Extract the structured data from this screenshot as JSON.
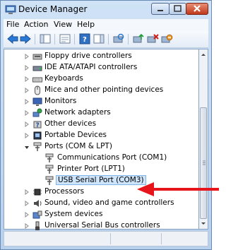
{
  "window": {
    "title": "Device Manager"
  },
  "menu": [
    "File",
    "Action",
    "View",
    "Help"
  ],
  "toolbar": {
    "icons": [
      "back-icon",
      "forward-icon",
      "show-hide-console-tree-icon",
      "properties-icon",
      "help-icon",
      "show-action-pane-icon",
      "scan-hardware-changes-icon",
      "update-driver-icon",
      "uninstall-icon",
      "disable-icon"
    ]
  },
  "tree": {
    "items": [
      {
        "label": "Floppy drive controllers",
        "expanded": false
      },
      {
        "label": "IDE ATA/ATAPI controllers",
        "expanded": false
      },
      {
        "label": "Keyboards",
        "expanded": false
      },
      {
        "label": "Mice and other pointing devices",
        "expanded": false
      },
      {
        "label": "Monitors",
        "expanded": false
      },
      {
        "label": "Network adapters",
        "expanded": false
      },
      {
        "label": "Other devices",
        "expanded": false
      },
      {
        "label": "Portable Devices",
        "expanded": false
      },
      {
        "label": "Ports (COM & LPT)",
        "expanded": true,
        "children": [
          {
            "label": "Communications Port (COM1)"
          },
          {
            "label": "Printer Port (LPT1)"
          },
          {
            "label": "USB Serial Port (COM3)",
            "selected": true
          }
        ]
      },
      {
        "label": "Processors",
        "expanded": false
      },
      {
        "label": "Sound, video and game controllers",
        "expanded": false
      },
      {
        "label": "System devices",
        "expanded": false
      },
      {
        "label": "Universal Serial Bus controllers",
        "expanded": false
      }
    ]
  },
  "colors": {
    "selection": "#cde4fb",
    "arrow": "#e8141c",
    "frame": "#b7d0ec"
  }
}
